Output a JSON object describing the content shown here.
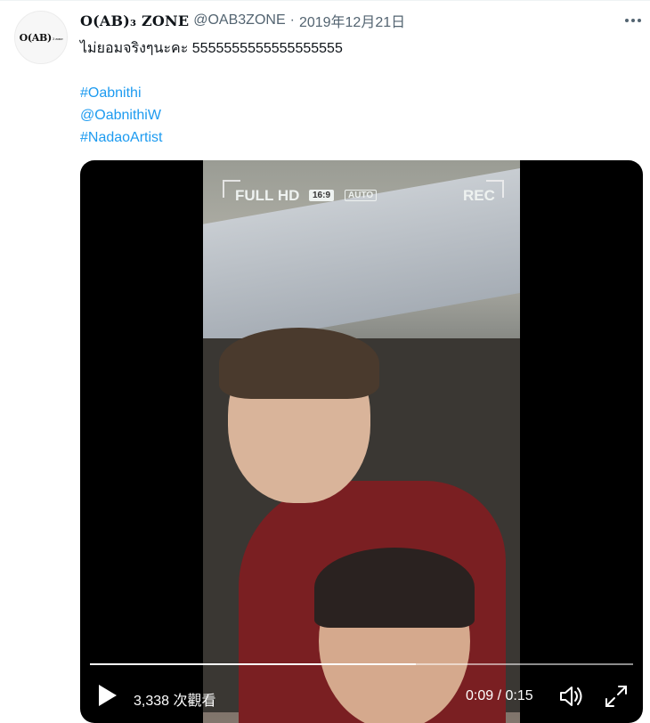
{
  "tweet": {
    "avatar_text": "O(AB)",
    "avatar_small_text": "3 zone",
    "display_name": "O(AB)₃ ZONE",
    "handle": "@OAB3ZONE",
    "separator": "·",
    "date": "2019年12月21日",
    "text_line1": "ไม่ยอมจริงๆนะคะ 5555555555555555555",
    "hashtag1": "#Oabnithi",
    "mention": "@OabnithiW",
    "hashtag2": "#NadaoArtist",
    "more_icon": "more-dots-icon"
  },
  "video": {
    "overlay_full_hd": "FULL HD",
    "overlay_aspect": "16:9",
    "overlay_auto": "AUTO",
    "overlay_rec": "REC",
    "views": "3,338 次觀看",
    "time": "0:09 / 0:15",
    "progress_fraction": 0.6,
    "play_icon": "play-icon",
    "volume_icon": "volume-icon",
    "fullscreen_icon": "fullscreen-icon"
  },
  "colors": {
    "link": "#1d9bf0",
    "secondary_text": "#536471",
    "primary_text": "#0f1419"
  }
}
